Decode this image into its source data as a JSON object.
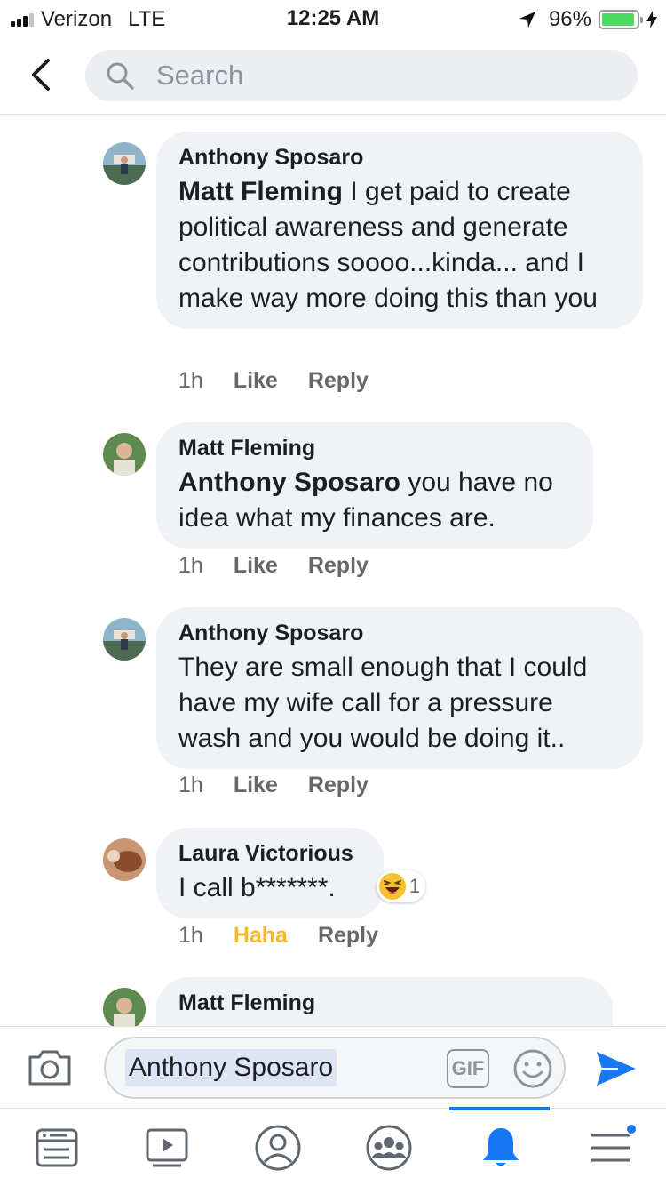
{
  "status_bar": {
    "carrier": "Verizon",
    "network": "LTE",
    "time": "12:25 AM",
    "battery_percent": "96%",
    "battery_level": 0.96
  },
  "header": {
    "search_placeholder": "Search"
  },
  "comments": [
    {
      "author": "Anthony Sposaro",
      "mention": "Matt Fleming",
      "text": " I get paid to create political awareness and generate contributions soooo...kinda... and I make way more doing this than you",
      "time": "1h",
      "like_label": "Like",
      "reply_label": "Reply"
    },
    {
      "author": "Matt Fleming",
      "mention": "Anthony Sposaro",
      "text": " you have no idea what my finances are.",
      "time": "1h",
      "like_label": "Like",
      "reply_label": "Reply"
    },
    {
      "author": "Anthony Sposaro",
      "mention": "",
      "text": "They are small enough that I could have my wife call for a pressure wash and you would be doing it..",
      "time": "1h",
      "like_label": "Like",
      "reply_label": "Reply"
    },
    {
      "author": "Laura Victorious",
      "mention": "",
      "text": "I call b*******.",
      "time": "1h",
      "like_label": "Haha",
      "reply_label": "Reply",
      "reaction_count": "1",
      "reaction_type": "haha-emoji-icon"
    },
    {
      "author": "Matt Fleming",
      "mention": "",
      "text": "",
      "time": "",
      "like_label": "",
      "reply_label": ""
    }
  ],
  "composer": {
    "input_value": "Anthony Sposaro",
    "gif_label": "GIF"
  },
  "tabbar": {
    "tabs": [
      "news-feed-icon",
      "watch-icon",
      "profile-icon",
      "groups-icon",
      "notifications-icon",
      "menu-icon"
    ],
    "active_tab": "notifications-icon"
  },
  "colors": {
    "accent": "#1877f2",
    "haha": "#f7b928",
    "bubble": "#f0f2f5",
    "battery": "#4cd964"
  }
}
